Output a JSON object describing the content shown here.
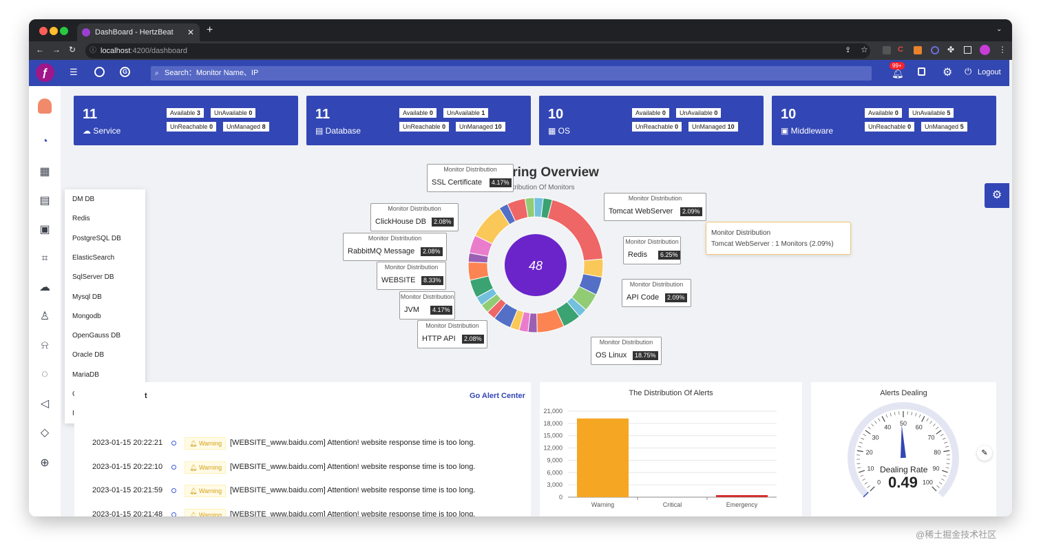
{
  "browser": {
    "tab_title": "DashBoard - HertzBeat",
    "url_host": "localhost",
    "url_path": ":4200/dashboard"
  },
  "appbar": {
    "search_placeholder": "Search：Monitor Name、IP",
    "notif_badge": "99+",
    "logout_label": "Logout"
  },
  "cards": [
    {
      "count": "11",
      "label": "Service",
      "available": "3",
      "unavailable": "0",
      "unreachable": "0",
      "unmanaged": "8"
    },
    {
      "count": "11",
      "label": "Database",
      "available": "0",
      "unavailable": "1",
      "unreachable": "0",
      "unmanaged": "10"
    },
    {
      "count": "10",
      "label": "OS",
      "available": "0",
      "unavailable": "0",
      "unreachable": "0",
      "unmanaged": "10"
    },
    {
      "count": "10",
      "label": "Middleware",
      "available": "0",
      "unavailable": "5",
      "unreachable": "0",
      "unmanaged": "5"
    }
  ],
  "badge_labels": {
    "available": "Available",
    "unavailable": "UnAvailable",
    "unreachable": "UnReachable",
    "unmanaged": "UnManaged"
  },
  "dropdown": [
    "DM DB",
    "Redis",
    "PostgreSQL DB",
    "ElasticSearch",
    "SqlServer DB",
    "Mysql DB",
    "Mongodb",
    "OpenGauss DB",
    "Oracle DB",
    "MariaDB",
    "ClickHouse DB",
    "IoTDB"
  ],
  "overview": {
    "title": "Monitoring Overview",
    "subtitle": "The Distribution Of Monitors",
    "total": "48",
    "box_header": "Monitor Distribution",
    "labels": [
      {
        "name": "SSL Certificate",
        "pct": "4.17%"
      },
      {
        "name": "Tomcat WebServer",
        "pct": "2.09%"
      },
      {
        "name": "ClickHouse DB",
        "pct": "2.08%"
      },
      {
        "name": "Redis",
        "pct": "6.25%"
      },
      {
        "name": "RabbitMQ Message",
        "pct": "2.08%"
      },
      {
        "name": "WEBSITE",
        "pct": "8.33%"
      },
      {
        "name": "API Code",
        "pct": "2.09%"
      },
      {
        "name": "JVM",
        "pct": "4.17%"
      },
      {
        "name": "HTTP API",
        "pct": "2.08%"
      },
      {
        "name": "OS Linux",
        "pct": "18.75%"
      }
    ],
    "tooltip": {
      "title": "Monitor Distribution",
      "text": "Tomcat WebServer : 1 Monitors (2.09%)"
    }
  },
  "alerts": {
    "title_partial": "t",
    "go_link": "Go Alert Center",
    "warning": "Warning",
    "rows": [
      {
        "time": "2023-01-15 20:22:21",
        "msg": "[WEBSITE_www.baidu.com] Attention! website response time is too long."
      },
      {
        "time": "2023-01-15 20:22:10",
        "msg": "[WEBSITE_www.baidu.com] Attention! website response time is too long."
      },
      {
        "time": "2023-01-15 20:21:59",
        "msg": "[WEBSITE_www.baidu.com] Attention! website response time is too long."
      },
      {
        "time": "2023-01-15 20:21:48",
        "msg": "[WEBSITE_www.baidu.com] Attention! website response time is too long."
      }
    ]
  },
  "chart_data": {
    "type": "bar",
    "title": "The Distribution Of Alerts",
    "categories": [
      "Warning",
      "Critical",
      "Emergency"
    ],
    "values": [
      19200,
      0,
      500
    ],
    "ylim": [
      0,
      21000
    ],
    "yticks": [
      "21,000",
      "18,000",
      "15,000",
      "12,000",
      "9,000",
      "6,000",
      "3,000",
      "0"
    ],
    "colors": [
      "#f5a623",
      "#3346b5",
      "#d32f2f"
    ]
  },
  "gauge": {
    "title": "Alerts Dealing",
    "label": "Dealing Rate",
    "value": "0.49",
    "ticks": [
      "0",
      "10",
      "20",
      "30",
      "40",
      "50",
      "60",
      "70",
      "80",
      "90",
      "100"
    ]
  },
  "watermark": "@稀土掘金技术社区"
}
